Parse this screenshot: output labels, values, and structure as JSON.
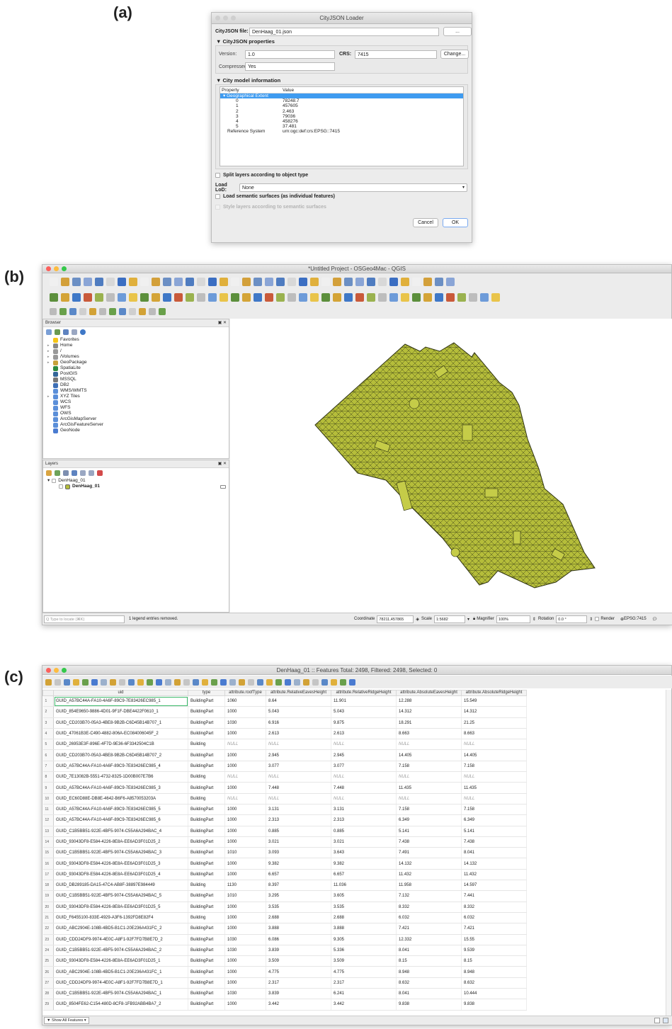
{
  "labels": {
    "a": "(a)",
    "b": "(b)",
    "c": "(c)"
  },
  "loader": {
    "title": "CityJSON Loader",
    "file_label": "CityJSON file:",
    "file_value": "DenHaag_01.json",
    "browse_label": "...",
    "props_section": "CityJSON properties",
    "version_label": "Version:",
    "version_value": "1.0",
    "crs_label": "CRS:",
    "crs_value": "7415",
    "change_label": "Change...",
    "compressed_label": "Compressed:",
    "compressed_value": "Yes",
    "info_section": "City model information",
    "col_property": "Property",
    "col_value": "Value",
    "extent_label": "Geographical Extent",
    "extent": [
      {
        "k": "0",
        "v": "78248.7"
      },
      {
        "k": "1",
        "v": "457605"
      },
      {
        "k": "2",
        "v": "2.463"
      },
      {
        "k": "3",
        "v": "79036"
      },
      {
        "k": "4",
        "v": "458276"
      },
      {
        "k": "5",
        "v": "37.481"
      }
    ],
    "refsys_label": "Reference System",
    "refsys_value": "urn:ogc:def:crs:EPSG::7415",
    "split_label": "Split layers according to object type",
    "lod_label": "Load LoD:",
    "lod_value": "None",
    "semantic_label": "Load semantic surfaces (as individual features)",
    "style_label": "Style layers according to semantic surfaces",
    "cancel_label": "Cancel",
    "ok_label": "OK"
  },
  "qgis": {
    "title": "*Untitled Project - OSGeo4Mac - QGIS",
    "browser_title": "Browser",
    "browser_items": [
      {
        "label": "Favorites",
        "color": "#f5c518"
      },
      {
        "label": "Home",
        "color": "#888"
      },
      {
        "label": "/",
        "color": "#999"
      },
      {
        "label": "/Volumes",
        "color": "#999"
      },
      {
        "label": "GeoPackage",
        "color": "#c7a23b"
      },
      {
        "label": "SpatiaLite",
        "color": "#2d8a3e"
      },
      {
        "label": "PostGIS",
        "color": "#336699"
      },
      {
        "label": "MSSQL",
        "color": "#777"
      },
      {
        "label": "DB2",
        "color": "#3d6fb5"
      },
      {
        "label": "WMS/WMTS",
        "color": "#5b8fd9"
      },
      {
        "label": "XYZ Tiles",
        "color": "#5b8fd9"
      },
      {
        "label": "WCS",
        "color": "#5b8fd9"
      },
      {
        "label": "WFS",
        "color": "#5b8fd9"
      },
      {
        "label": "OWS",
        "color": "#5b8fd9"
      },
      {
        "label": "ArcGisMapServer",
        "color": "#5b8fd9"
      },
      {
        "label": "ArcGisFeatureServer",
        "color": "#5b8fd9"
      },
      {
        "label": "GeoNode",
        "color": "#4a7bd0"
      }
    ],
    "layers_title": "Layers",
    "group_name": "DenHaag_01",
    "layer_name": "DenHaag_01",
    "locate_placeholder": "Q  Type to locate (⌘K)",
    "status_msg": "1 legend entries removed.",
    "coord_label": "Coordinate",
    "coord_value": "78211,457865",
    "scale_label": "Scale",
    "scale_value": "1:5682",
    "magnifier_label": "Magnifier",
    "magnifier_value": "100%",
    "rotation_label": "Rotation",
    "rotation_value": "0.0 °",
    "render_label": "Render",
    "epsg_label": "EPSG:7415",
    "poly_color": "#b5bd3a"
  },
  "attr": {
    "title": "DenHaag_01 :: Features Total: 2498, Filtered: 2498, Selected: 0",
    "columns": [
      "uid",
      "type",
      "attribute.roofType",
      "attribute.RelativeEavesHeight",
      "attribute.RelativeRidgeHeight",
      "attribute.AbsoluteEavesHeight",
      "attribute.AbsoluteRidgeHeight"
    ],
    "rows": [
      [
        "GUID_A57BC44A-FA10-4A6F-89C9-7E83426EC985_1",
        "BuildingPart",
        "1060",
        "8.64",
        "11.901",
        "12.288",
        "15.549"
      ],
      [
        "GUID_854E9650-9886-4D01-9F1F-DBE4422F0610_1",
        "BuildingPart",
        "1000",
        "5.043",
        "5.043",
        "14.312",
        "14.312"
      ],
      [
        "GUID_CD203B70-05A3-4BE8-9B2B-C6D45B14B707_1",
        "BuildingPart",
        "1030",
        "6.916",
        "9.875",
        "18.291",
        "21.25"
      ],
      [
        "GUID_47061B3E-C490-4882-806A-EC084006045F_2",
        "BuildingPart",
        "1000",
        "2.613",
        "2.613",
        "8.663",
        "8.663"
      ],
      [
        "GUID_26953E3F-896E-4F7D-9E36-6F3342504C1B",
        "Building",
        "NULL",
        "NULL",
        "NULL",
        "NULL",
        "NULL"
      ],
      [
        "GUID_CD203B70-05A3-4BE8-9B2B-C6D45B14B707_2",
        "BuildingPart",
        "1000",
        "2.945",
        "2.945",
        "14.405",
        "14.405"
      ],
      [
        "GUID_A57BC44A-FA10-4A6F-89C9-7E83426EC985_4",
        "BuildingPart",
        "1000",
        "3.077",
        "3.077",
        "7.158",
        "7.158"
      ],
      [
        "GUID_7E13082B-5551-4732-8325-1D00B007E7B6",
        "Building",
        "NULL",
        "NULL",
        "NULL",
        "NULL",
        "NULL"
      ],
      [
        "GUID_A57BC44A-FA10-4A6F-89C9-7E83426EC985_3",
        "BuildingPart",
        "1000",
        "7.448",
        "7.448",
        "11.435",
        "11.435"
      ],
      [
        "GUID_EC60D88E-DB8E-4642-B6F6-A8570053203A",
        "Building",
        "NULL",
        "NULL",
        "NULL",
        "NULL",
        "NULL"
      ],
      [
        "GUID_A57BC44A-FA10-4A6F-89C9-7E83426EC985_5",
        "BuildingPart",
        "1000",
        "3.131",
        "3.131",
        "7.158",
        "7.158"
      ],
      [
        "GUID_A57BC44A-FA10-4A6F-89C9-7E83426EC985_6",
        "BuildingPart",
        "1000",
        "2.313",
        "2.313",
        "6.349",
        "6.349"
      ],
      [
        "GUID_C1B5BB51-922E-4BF5-9074-C55A6A294BAC_4",
        "BuildingPart",
        "1000",
        "0.885",
        "0.885",
        "5.141",
        "5.141"
      ],
      [
        "GUID_93043DF8-E584-4226-8E8A-EE6AD3F01D25_2",
        "BuildingPart",
        "1000",
        "3.021",
        "3.021",
        "7.438",
        "7.438"
      ],
      [
        "GUID_C1B5BB51-922E-4BF5-9074-C55A6A294BAC_3",
        "BuildingPart",
        "1010",
        "3.093",
        "3.643",
        "7.491",
        "8.041"
      ],
      [
        "GUID_93043DF8-E584-4226-8E8A-EE6AD3F01D25_3",
        "BuildingPart",
        "1000",
        "9.382",
        "9.382",
        "14.132",
        "14.132"
      ],
      [
        "GUID_93043DF8-E584-4226-8E8A-EE6AD3F01D25_4",
        "BuildingPart",
        "1000",
        "6.657",
        "6.657",
        "11.432",
        "11.432"
      ],
      [
        "GUID_DB289185-DA15-47C4-AB8F-38897E984449",
        "Building",
        "1130",
        "8.397",
        "11.036",
        "11.958",
        "14.597"
      ],
      [
        "GUID_C1B5BB51-922E-4BF5-9074-C55A6A294BAC_5",
        "BuildingPart",
        "1010",
        "3.295",
        "3.605",
        "7.132",
        "7.441"
      ],
      [
        "GUID_93043DF8-E584-4226-8E8A-EE6AD3F01D25_5",
        "BuildingPart",
        "1000",
        "3.535",
        "3.535",
        "8.332",
        "8.332"
      ],
      [
        "GUID_F6455100-833E-4929-A3F6-1392FD8E82F4",
        "Building",
        "1000",
        "2.688",
        "2.688",
        "6.032",
        "6.032"
      ],
      [
        "GUID_ABC2904E-108B-4BD5-B1C1-20E236A431FC_2",
        "BuildingPart",
        "1000",
        "3.888",
        "3.888",
        "7.421",
        "7.421"
      ],
      [
        "GUID_CDD24DF9-9974-4E0C-A8F1-92F7FD7B8E7D_2",
        "BuildingPart",
        "1030",
        "6.086",
        "9.305",
        "12.332",
        "15.55"
      ],
      [
        "GUID_C1B5BB51-922E-4BF5-9074-C55A6A294BAC_2",
        "BuildingPart",
        "1030",
        "3.839",
        "5.336",
        "8.041",
        "9.539"
      ],
      [
        "GUID_93043DF8-E584-4226-8E8A-EE6AD3F01D25_1",
        "BuildingPart",
        "1000",
        "3.509",
        "3.509",
        "8.15",
        "8.15"
      ],
      [
        "GUID_ABC2904E-108B-4BD5-B1C1-20E236A431FC_1",
        "BuildingPart",
        "1000",
        "4.775",
        "4.775",
        "8.948",
        "8.948"
      ],
      [
        "GUID_CDD24DF9-9974-4E0C-A8F1-92F7FD7B8E7D_1",
        "BuildingPart",
        "1000",
        "2.317",
        "2.317",
        "8.632",
        "8.632"
      ],
      [
        "GUID_C1B5BB51-922E-4BF5-9074-C55A6A294BAC_1",
        "BuildingPart",
        "1030",
        "3.839",
        "6.241",
        "8.041",
        "10.444"
      ],
      [
        "GUID_8504FE62-C154-480D-8CF8-1FB92ABB4BA7_2",
        "BuildingPart",
        "1000",
        "3.442",
        "3.442",
        "9.838",
        "9.838"
      ]
    ],
    "show_all_label": "Show All Features"
  }
}
